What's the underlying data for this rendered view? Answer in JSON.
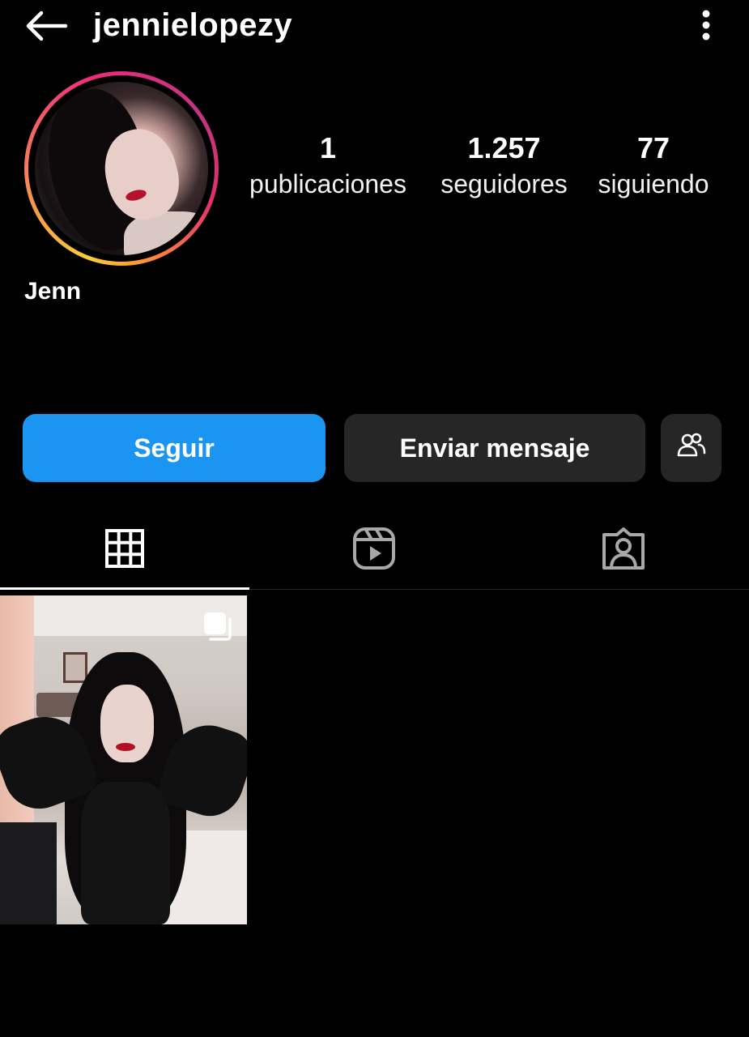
{
  "header": {
    "username": "jennielopezy",
    "back_icon": "arrow-left-icon",
    "more_icon": "vertical-dots-icon"
  },
  "profile": {
    "display_name": "Jenn",
    "avatar_ring_colors": [
      "#f9ce34",
      "#ee2a7b",
      "#c13584",
      "#fd8d32"
    ]
  },
  "stats": {
    "posts": {
      "value": "1",
      "label": "publicaciones"
    },
    "followers": {
      "value": "1.257",
      "label": "seguidores"
    },
    "following": {
      "value": "77",
      "label": "siguiendo"
    }
  },
  "actions": {
    "follow_label": "Seguir",
    "message_label": "Enviar mensaje",
    "suggest_icon": "people-icon",
    "follow_color": "#1a95f2",
    "secondary_color": "#262626"
  },
  "tabs": [
    {
      "icon": "grid-icon",
      "active": true
    },
    {
      "icon": "reels-icon",
      "active": false
    },
    {
      "icon": "tagged-icon",
      "active": false
    }
  ],
  "posts": [
    {
      "type": "carousel",
      "icon": "carousel-icon"
    }
  ]
}
